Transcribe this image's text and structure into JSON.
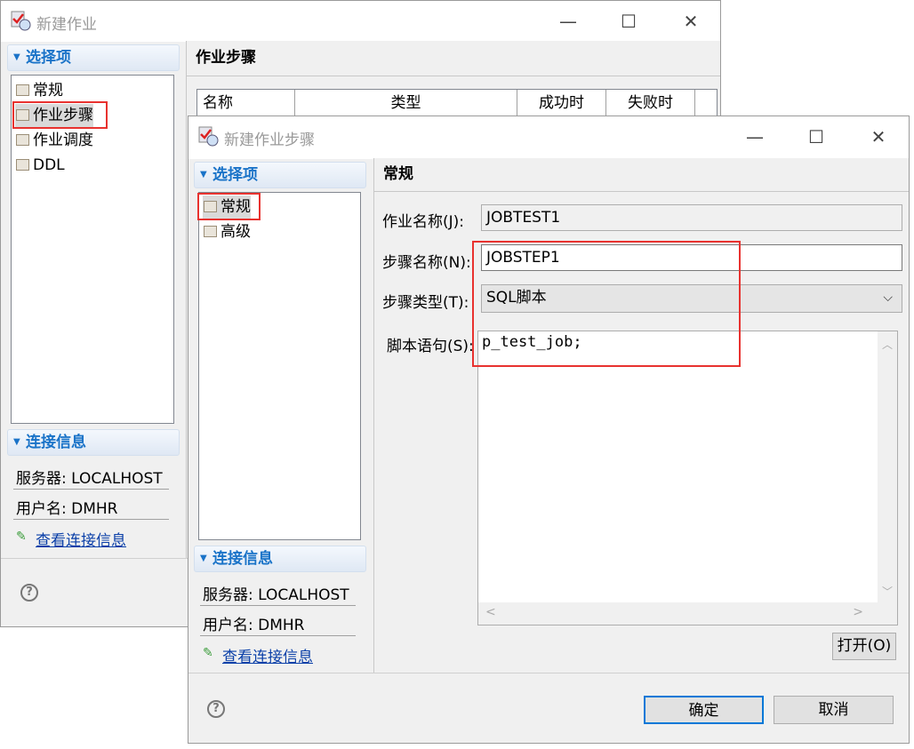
{
  "back_window": {
    "title": "新建作业",
    "select_header": "选择项",
    "tree": [
      "常规",
      "作业步骤",
      "作业调度",
      "DDL"
    ],
    "selected": "作业步骤",
    "panel_title": "作业步骤",
    "table_headers": [
      "名称",
      "类型",
      "成功时",
      "失败时"
    ],
    "conn_header": "连接信息",
    "server": "服务器: LOCALHOST",
    "user": "用户名: DMHR",
    "view_conn": "查看连接信息",
    "help": "?"
  },
  "front_window": {
    "title": "新建作业步骤",
    "select_header": "选择项",
    "tree": [
      "常规",
      "高级"
    ],
    "selected": "常规",
    "panel_title": "常规",
    "job_name_label": "作业名称(J):",
    "job_name": "JOBTEST1",
    "step_name_label": "步骤名称(N):",
    "step_name": "JOBSTEP1",
    "step_type_label": "步骤类型(T):",
    "step_type": "SQL脚本",
    "script_label": "脚本语句(S):",
    "script": "p_test_job;",
    "open_button": "打开(O)",
    "conn_header": "连接信息",
    "server": "服务器: LOCALHOST",
    "user": "用户名: DMHR",
    "view_conn": "查看连接信息",
    "ok": "确定",
    "cancel": "取消",
    "help": "?"
  },
  "window_controls": {
    "min": "—",
    "max": "☐",
    "close": "✕"
  }
}
